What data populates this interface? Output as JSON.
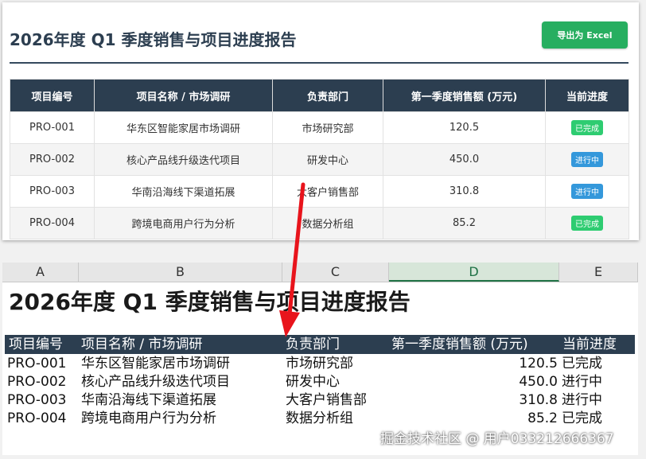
{
  "web": {
    "title": "2026年度 Q1 季度销售与项目进度报告",
    "export_label": "导出为 Excel",
    "columns": [
      "项目编号",
      "项目名称 / 市场调研",
      "负责部门",
      "第一季度销售额 (万元)",
      "当前进度"
    ],
    "rows": [
      {
        "id": "PRO-001",
        "name": "华东区智能家居市场调研",
        "dept": "市场研究部",
        "sales": "120.5",
        "status": "已完成",
        "status_kind": "done"
      },
      {
        "id": "PRO-002",
        "name": "核心产品线升级迭代项目",
        "dept": "研发中心",
        "sales": "450.0",
        "status": "进行中",
        "status_kind": "progress"
      },
      {
        "id": "PRO-003",
        "name": "华南沿海线下渠道拓展",
        "dept": "大客户销售部",
        "sales": "310.8",
        "status": "进行中",
        "status_kind": "progress"
      },
      {
        "id": "PRO-004",
        "name": "跨境电商用户行为分析",
        "dept": "数据分析组",
        "sales": "85.2",
        "status": "已完成",
        "status_kind": "done"
      }
    ],
    "colors": {
      "header_bg": "#2c3e50",
      "button_bg": "#27ae60",
      "done": "#2ecc71",
      "progress": "#3498db"
    }
  },
  "sheet": {
    "column_letters": [
      "A",
      "B",
      "C",
      "D",
      "E"
    ],
    "selected_column": "D",
    "title": "2026年度 Q1 季度销售与项目进度报告",
    "headers": [
      "项目编号",
      "项目名称 / 市场调研",
      "负责部门",
      "第一季度销售额 (万元)",
      "当前进度"
    ],
    "rows": [
      {
        "id": "PRO-001",
        "name": "华东区智能家居市场调研",
        "dept": "市场研究部",
        "sales": "120.5",
        "status": "已完成"
      },
      {
        "id": "PRO-002",
        "name": "核心产品线升级迭代项目",
        "dept": "研发中心",
        "sales": "450.0",
        "status": "进行中"
      },
      {
        "id": "PRO-003",
        "name": "华南沿海线下渠道拓展",
        "dept": "大客户销售部",
        "sales": "310.8",
        "status": "进行中"
      },
      {
        "id": "PRO-004",
        "name": "跨境电商用户行为分析",
        "dept": "数据分析组",
        "sales": "85.2",
        "status": "已完成"
      }
    ]
  },
  "arrow_icon": "down-arrow-icon",
  "watermark": "掘金技术社区 @ 用户033212666367"
}
